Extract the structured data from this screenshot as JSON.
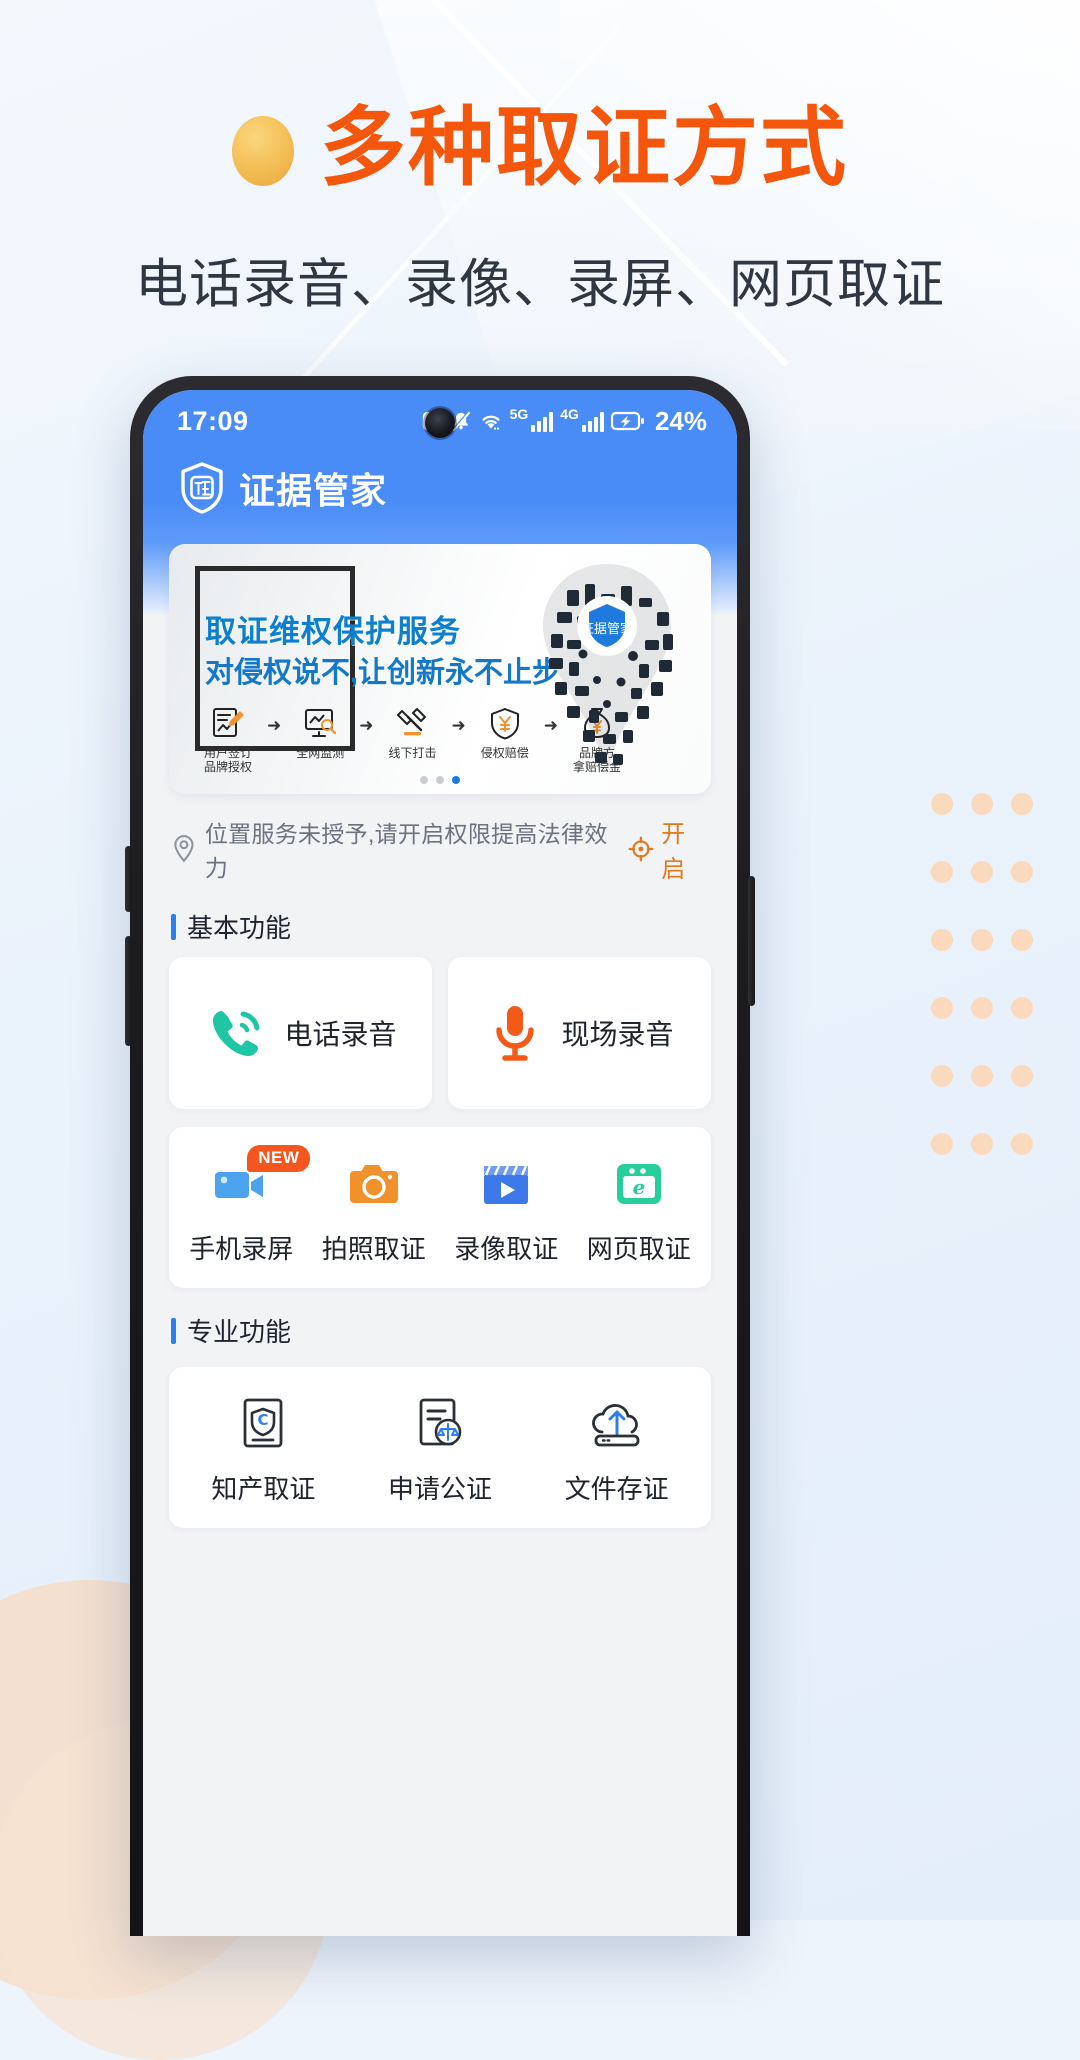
{
  "promo": {
    "title": "多种取证方式",
    "subtitle": "电话录音、录像、录屏、网页取证",
    "title_color": "#f4560b",
    "bullet_color": "#f3bd53"
  },
  "phone": {
    "statusbar": {
      "time": "17:09",
      "battery_percent": "24%",
      "network_5g": "5G",
      "network_4g": "4G",
      "icons": [
        "nfc-icon",
        "bell-muted-icon",
        "wifi-icon",
        "signal-5g-icon",
        "signal-4g-icon",
        "battery-charging-icon"
      ]
    },
    "app": {
      "name": "证据管家",
      "logo": "shield-zheng-icon",
      "header_color": "#4a8cf7"
    },
    "banner": {
      "headline": "取证维权保护服务",
      "subline": "对侵权说不,让创新永不止步",
      "flow": [
        {
          "icon": "document-sign-icon",
          "label": "用户签订\n品牌授权"
        },
        {
          "icon": "monitor-chart-icon",
          "label": "全网监测"
        },
        {
          "icon": "gavel-icon",
          "label": "线下打击"
        },
        {
          "icon": "shield-yuan-icon",
          "label": "侵权赔偿"
        },
        {
          "icon": "money-bag-icon",
          "label": "品牌方\n拿赔偿金"
        }
      ],
      "dots_total": 3,
      "dots_active": 3
    },
    "location_notice": {
      "icon": "location-pin-icon",
      "text": "位置服务未授予,请开启权限提高法律效力",
      "action_icon": "crosshair-icon",
      "action_label": "开启",
      "action_color": "#e07a1f"
    },
    "sections": [
      {
        "title": "基本功能",
        "basic_items": [
          {
            "icon": "phone-call-icon",
            "label": "电话录音",
            "color": "#1fc6a6"
          },
          {
            "icon": "microphone-icon",
            "label": "现场录音",
            "color": "#f45a17"
          }
        ],
        "grid_items": [
          {
            "icon": "video-camera-icon",
            "label": "手机录屏",
            "color": "#4aa3ec",
            "badge": "NEW"
          },
          {
            "icon": "camera-icon",
            "label": "拍照取证",
            "color": "#f0912c",
            "badge": ""
          },
          {
            "icon": "clapperboard-icon",
            "label": "录像取证",
            "color": "#3c78e8",
            "badge": ""
          },
          {
            "icon": "browser-e-icon",
            "label": "网页取证",
            "color": "#25ce9a",
            "badge": ""
          }
        ]
      },
      {
        "title": "专业功能",
        "grid_items": [
          {
            "icon": "certificate-shield-icon",
            "label": "知产取证",
            "color": "#2f7ef0"
          },
          {
            "icon": "document-scales-icon",
            "label": "申请公证",
            "color": "#2f7ef0"
          },
          {
            "icon": "cloud-upload-icon",
            "label": "文件存证",
            "color": "#2f7ef0"
          }
        ]
      }
    ]
  }
}
